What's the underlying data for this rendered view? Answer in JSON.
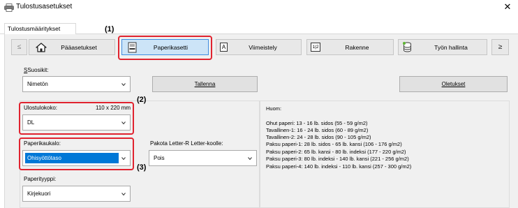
{
  "window": {
    "title": "Tulostusasetukset",
    "close_label": "✕"
  },
  "tab": {
    "label": "Tulostusmääritykset"
  },
  "nav": {
    "left_scroll": "≤",
    "right_scroll": "≥",
    "buttons": [
      {
        "label": "Pääasetukset"
      },
      {
        "label": "Paperikasetti"
      },
      {
        "label": "Viimeistely"
      },
      {
        "label": "Rakenne"
      },
      {
        "label": "Työn hallinta"
      }
    ],
    "rakenne_icon_text": "1|2",
    "viimeistely_icon_text": "A"
  },
  "callouts": {
    "c1": "(1)",
    "c2": "(2)",
    "c3": "(3)"
  },
  "favorites": {
    "label": "Suosikit:",
    "value": "Nimetön",
    "save_button": "Tallenna",
    "defaults_button": "Oletukset"
  },
  "output_size": {
    "label": "Ulostulokoko:",
    "dimensions": "110 x 220 mm",
    "value": "DL"
  },
  "paper_tray": {
    "label": "Paperikaukalo:",
    "value": "Ohisyöttötaso"
  },
  "force_letter": {
    "label": "Pakota Letter-R Letter-koolle:",
    "value": "Pois"
  },
  "paper_type": {
    "label": "Paperityyppi:",
    "value": "Kirjekuori"
  },
  "notes": {
    "title": "Huom:",
    "lines": [
      "Ohut paperi: 13 - 16 lb. sidos (55 - 59 g/m2)",
      "Tavallinen-1: 16 - 24 lb. sidos (60 - 89 g/m2)",
      "Tavallinen-2: 24 - 28 lb. sidos (90 - 105 g/m2)",
      "Paksu paperi-1: 28 lb. sidos - 65 lb. kansi (106 - 176 g/m2)",
      "Paksu paperi-2: 65 lb. kansi - 80 lb. indeksi (177 - 220 g/m2)",
      "Paksu paperi-3: 80 lb. indeksi - 140 lb. kansi (221 - 256 g/m2)",
      "Paksu paperi-4: 140 lb. indeksi - 110 lb. kansi (257 - 300 g/m2)"
    ]
  },
  "colors": {
    "highlight_red": "#e0232f",
    "selected_blue": "#0078d7"
  }
}
